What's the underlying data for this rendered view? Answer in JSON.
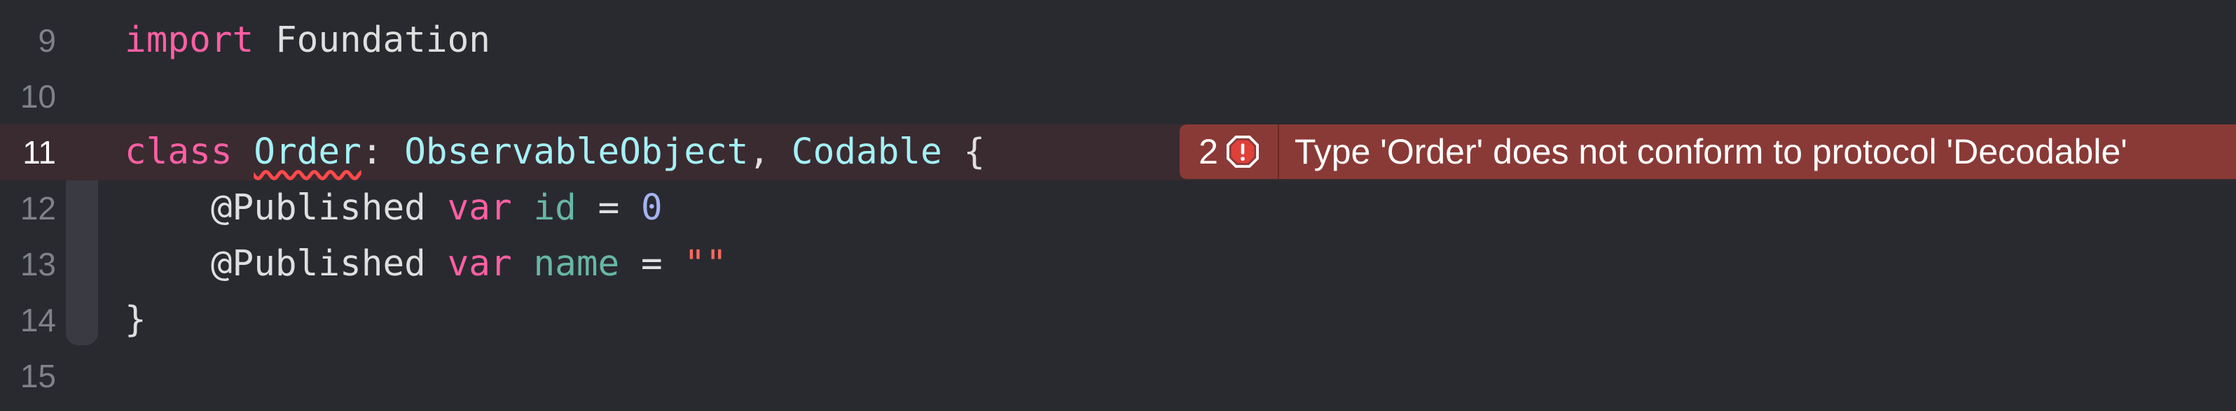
{
  "lines": [
    {
      "number": "9",
      "tokens": [
        {
          "t": "import",
          "c": "kw"
        },
        {
          "t": " Foundation",
          "c": "plain"
        }
      ]
    },
    {
      "number": "10",
      "tokens": []
    },
    {
      "number": "11",
      "tokens": [
        {
          "t": "class",
          "c": "kw"
        },
        {
          "t": " ",
          "c": "plain"
        },
        {
          "t": "Order",
          "c": "typename-err"
        },
        {
          "t": ": ",
          "c": "plain"
        },
        {
          "t": "ObservableObject",
          "c": "type"
        },
        {
          "t": ", ",
          "c": "plain"
        },
        {
          "t": "Codable",
          "c": "type"
        },
        {
          "t": " {",
          "c": "plain"
        }
      ]
    },
    {
      "number": "12",
      "tokens": [
        {
          "t": "    @Published",
          "c": "attr"
        },
        {
          "t": " ",
          "c": "plain"
        },
        {
          "t": "var",
          "c": "kw"
        },
        {
          "t": " ",
          "c": "plain"
        },
        {
          "t": "id",
          "c": "prop"
        },
        {
          "t": " = ",
          "c": "plain"
        },
        {
          "t": "0",
          "c": "num-lit"
        }
      ]
    },
    {
      "number": "13",
      "tokens": [
        {
          "t": "    @Published",
          "c": "attr"
        },
        {
          "t": " ",
          "c": "plain"
        },
        {
          "t": "var",
          "c": "kw"
        },
        {
          "t": " ",
          "c": "plain"
        },
        {
          "t": "name",
          "c": "prop"
        },
        {
          "t": " = ",
          "c": "plain"
        },
        {
          "t": "\"\"",
          "c": "str"
        }
      ]
    },
    {
      "number": "14",
      "tokens": [
        {
          "t": "}",
          "c": "plain"
        }
      ]
    },
    {
      "number": "15",
      "tokens": []
    }
  ],
  "issue": {
    "count": "2",
    "icon": "error-octagon-icon",
    "message": "Type 'Order' does not conform to protocol 'Decodable'"
  },
  "colors": {
    "background": "#292a30",
    "error_line": "#3a2b30",
    "issue_badge": "#8a3a36",
    "keyword": "#fc5fa3",
    "type": "#a3f1f7"
  }
}
